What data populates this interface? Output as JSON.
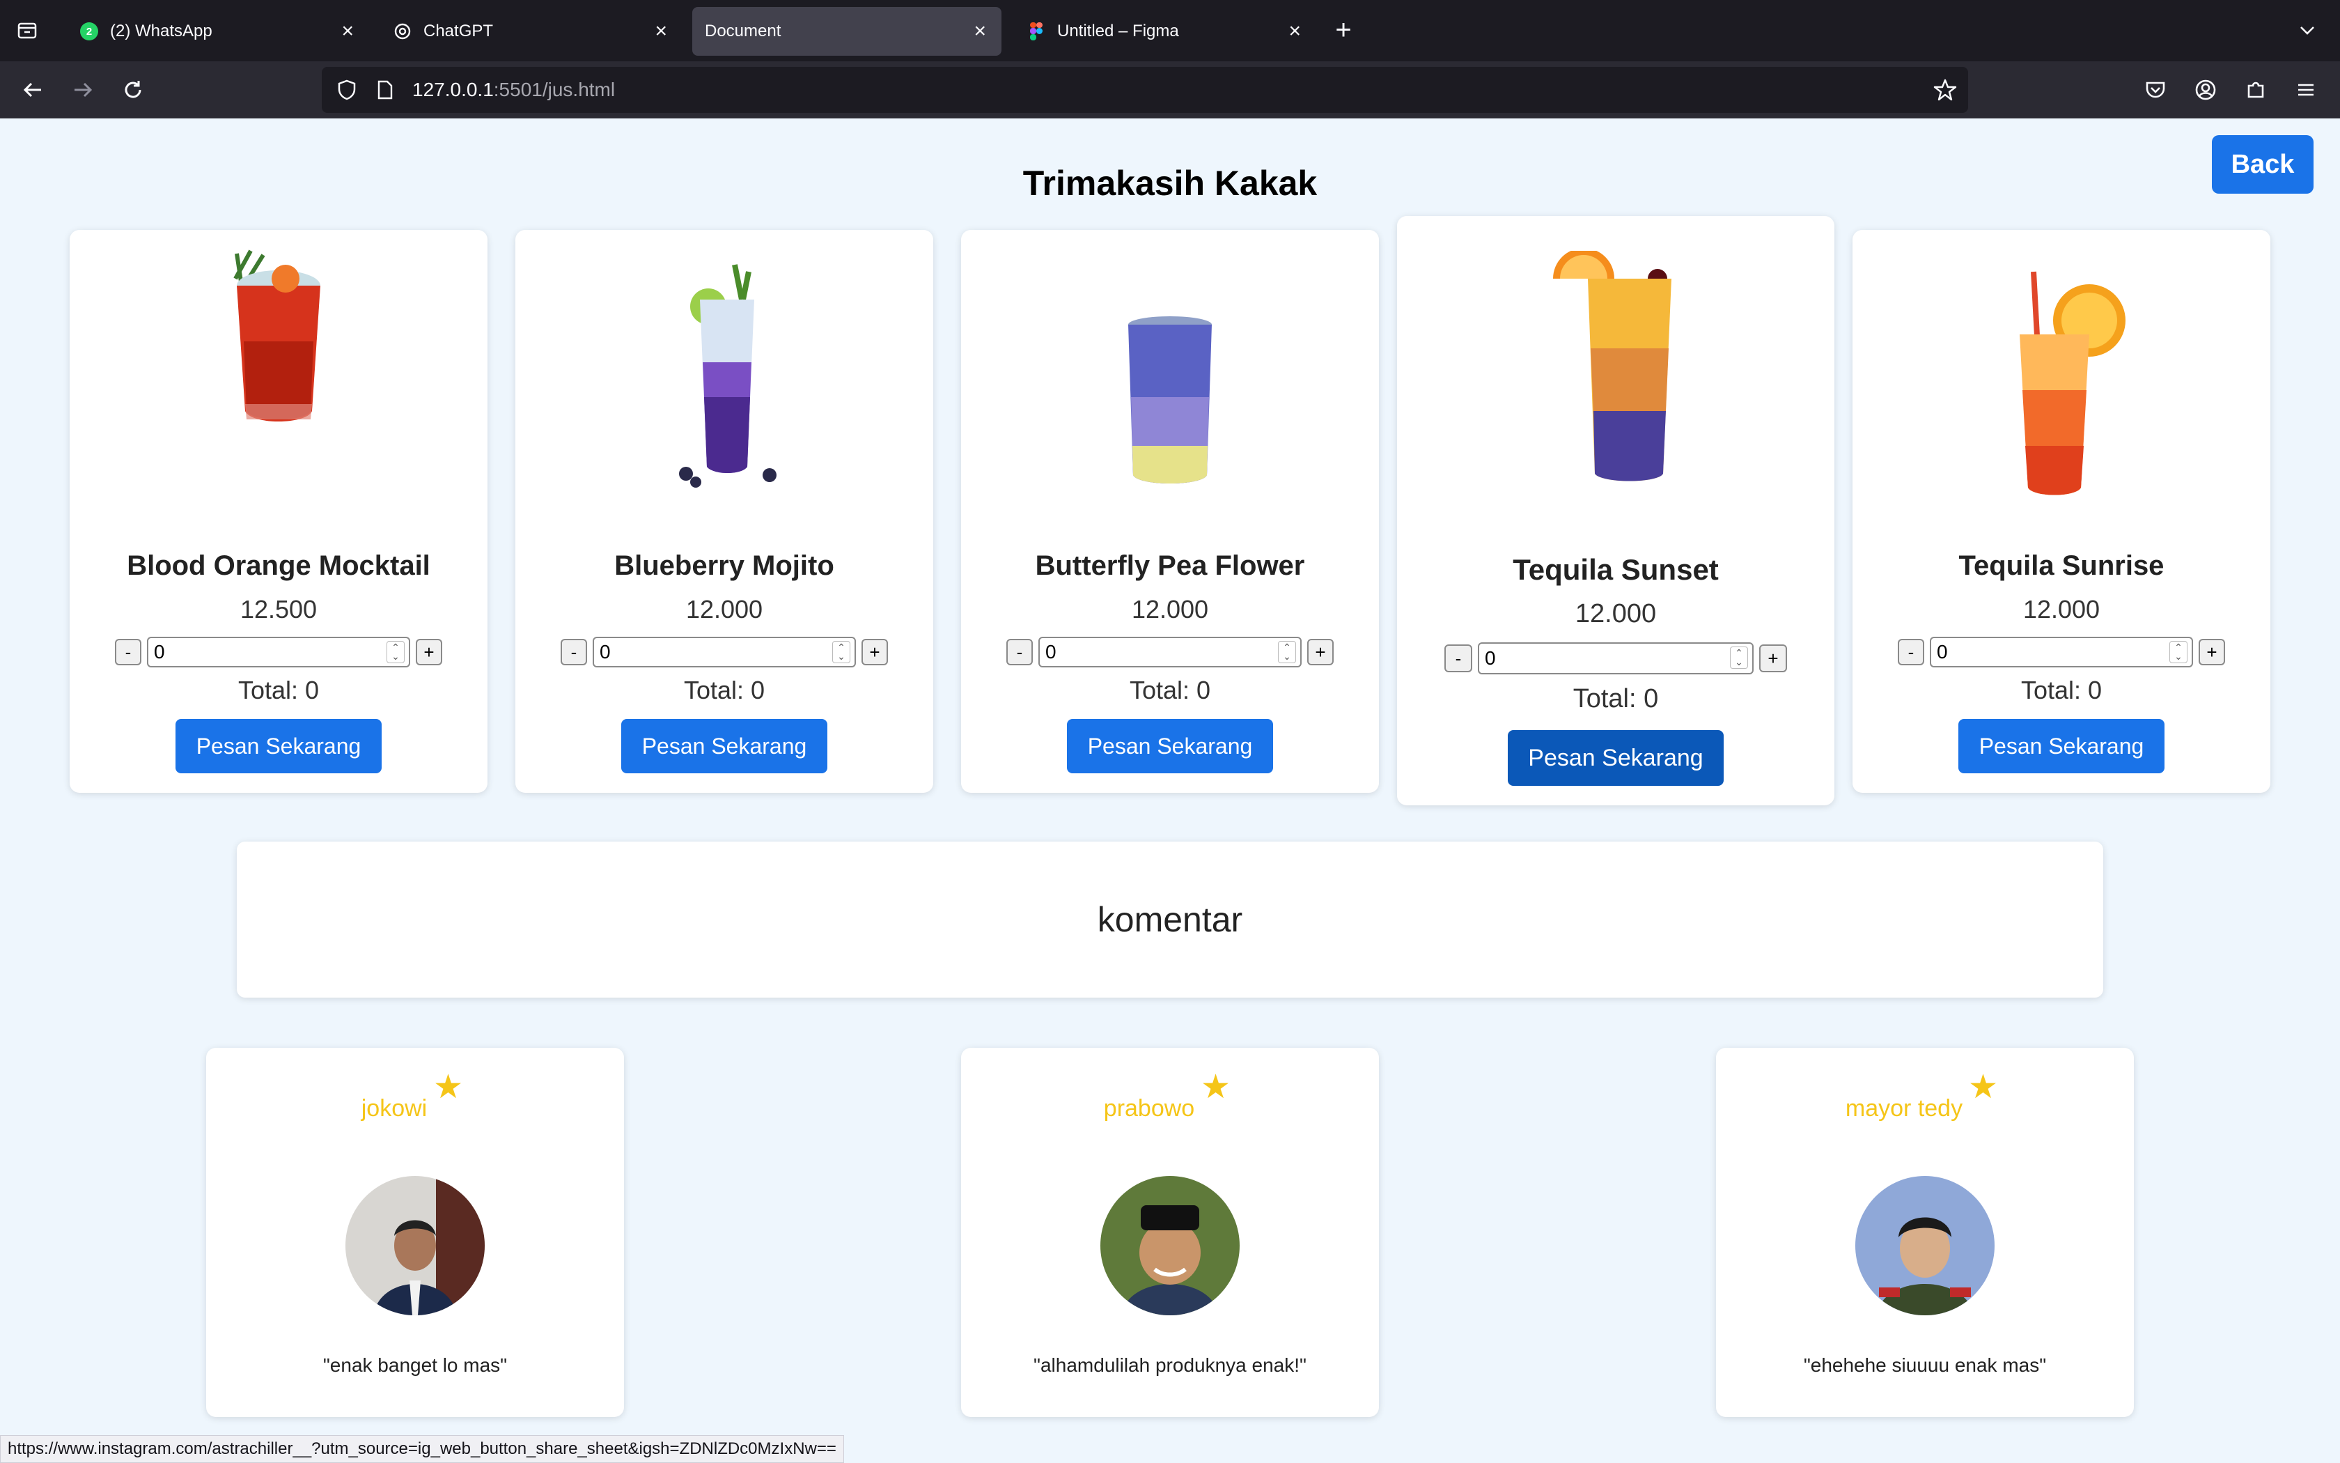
{
  "browser": {
    "tabs": [
      {
        "title": "(2) WhatsApp",
        "icon": "whatsapp-icon",
        "badge": "2"
      },
      {
        "title": "ChatGPT",
        "icon": "chatgpt-icon"
      },
      {
        "title": "Document",
        "icon": "",
        "active": true
      },
      {
        "title": "Untitled – Figma",
        "icon": "figma-icon"
      }
    ],
    "url_host": "127.0.0.1",
    "url_path": ":5501/jus.html"
  },
  "page": {
    "title": "Trimakasih Kakak",
    "back_label": "Back",
    "comment_heading": "komentar"
  },
  "products": [
    {
      "name": "Blood Orange Mocktail",
      "price": "12.500",
      "qty": "0",
      "total": "Total: 0",
      "button": "Pesan Sekarang"
    },
    {
      "name": "Blueberry Mojito",
      "price": "12.000",
      "qty": "0",
      "total": "Total: 0",
      "button": "Pesan Sekarang"
    },
    {
      "name": "Butterfly Pea Flower",
      "price": "12.000",
      "qty": "0",
      "total": "Total: 0",
      "button": "Pesan Sekarang"
    },
    {
      "name": "Tequila Sunset",
      "price": "12.000",
      "qty": "0",
      "total": "Total: 0",
      "button": "Pesan Sekarang"
    },
    {
      "name": "Tequila Sunrise",
      "price": "12.000",
      "qty": "0",
      "total": "Total: 0",
      "button": "Pesan Sekarang"
    }
  ],
  "qty_controls": {
    "minus": "-",
    "plus": "+"
  },
  "reviews": [
    {
      "name": "jokowi",
      "quote": "\"enak banget lo mas\""
    },
    {
      "name": "prabowo",
      "quote": "\"alhamdulilah produknya enak!\""
    },
    {
      "name": "mayor tedy",
      "quote": "\"ehehehe siuuuu enak mas\""
    }
  ],
  "status_url": "https://www.instagram.com/astrachiller__?utm_source=ig_web_button_share_sheet&igsh=ZDNlZDc0MzIxNw==",
  "colors": {
    "accent": "#1a73e8",
    "star": "#f5c518",
    "chrome_dark": "#1c1b22"
  }
}
